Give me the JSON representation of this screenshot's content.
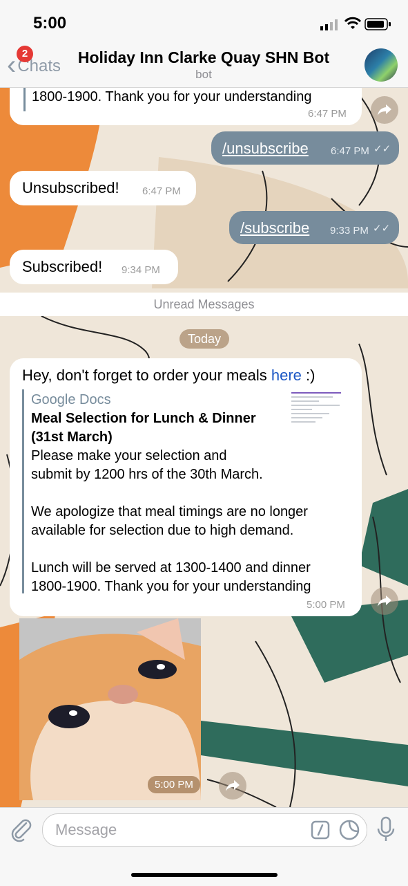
{
  "status_bar": {
    "time": "5:00"
  },
  "header": {
    "back_label": "Chats",
    "badge_count": "2",
    "title": "Holiday Inn Clarke Quay SHN Bot",
    "subtitle": "bot"
  },
  "messages": {
    "m1": {
      "text": "1800-1900. Thank you for your understanding",
      "time": "6:47 PM"
    },
    "m2": {
      "text": "/unsubscribe",
      "time": "6:47 PM"
    },
    "m3": {
      "text": "Unsubscribed!",
      "time": "6:47 PM"
    },
    "m4": {
      "text": "/subscribe",
      "time": "9:33 PM"
    },
    "m5": {
      "text": "Subscribed!",
      "time": "9:34 PM"
    }
  },
  "divider": {
    "unread": "Unread Messages",
    "date": "Today"
  },
  "reminder": {
    "text_before_link": "Hey, don't forget to order your meals ",
    "link_text": "here",
    "text_after_link": " :)",
    "time": "5:00 PM",
    "preview": {
      "site_name": "Google Docs",
      "title": "Meal Selection for Lunch & Dinner (31st March)",
      "description": "Please make your selection and\nsubmit by 1200 hrs of the 30th March.\n\nWe apologize that meal timings are no longer\navailable for selection due to high demand.\n\nLunch will be served at 1300-1400 and dinner\n1800-1900. Thank you for your understanding"
    }
  },
  "photo_message": {
    "time": "5:00 PM"
  },
  "input_bar": {
    "placeholder": "Message"
  },
  "colors": {
    "outgoing_bubble": "#778c9c",
    "link": "#1a56c4",
    "badge": "#e53935"
  }
}
